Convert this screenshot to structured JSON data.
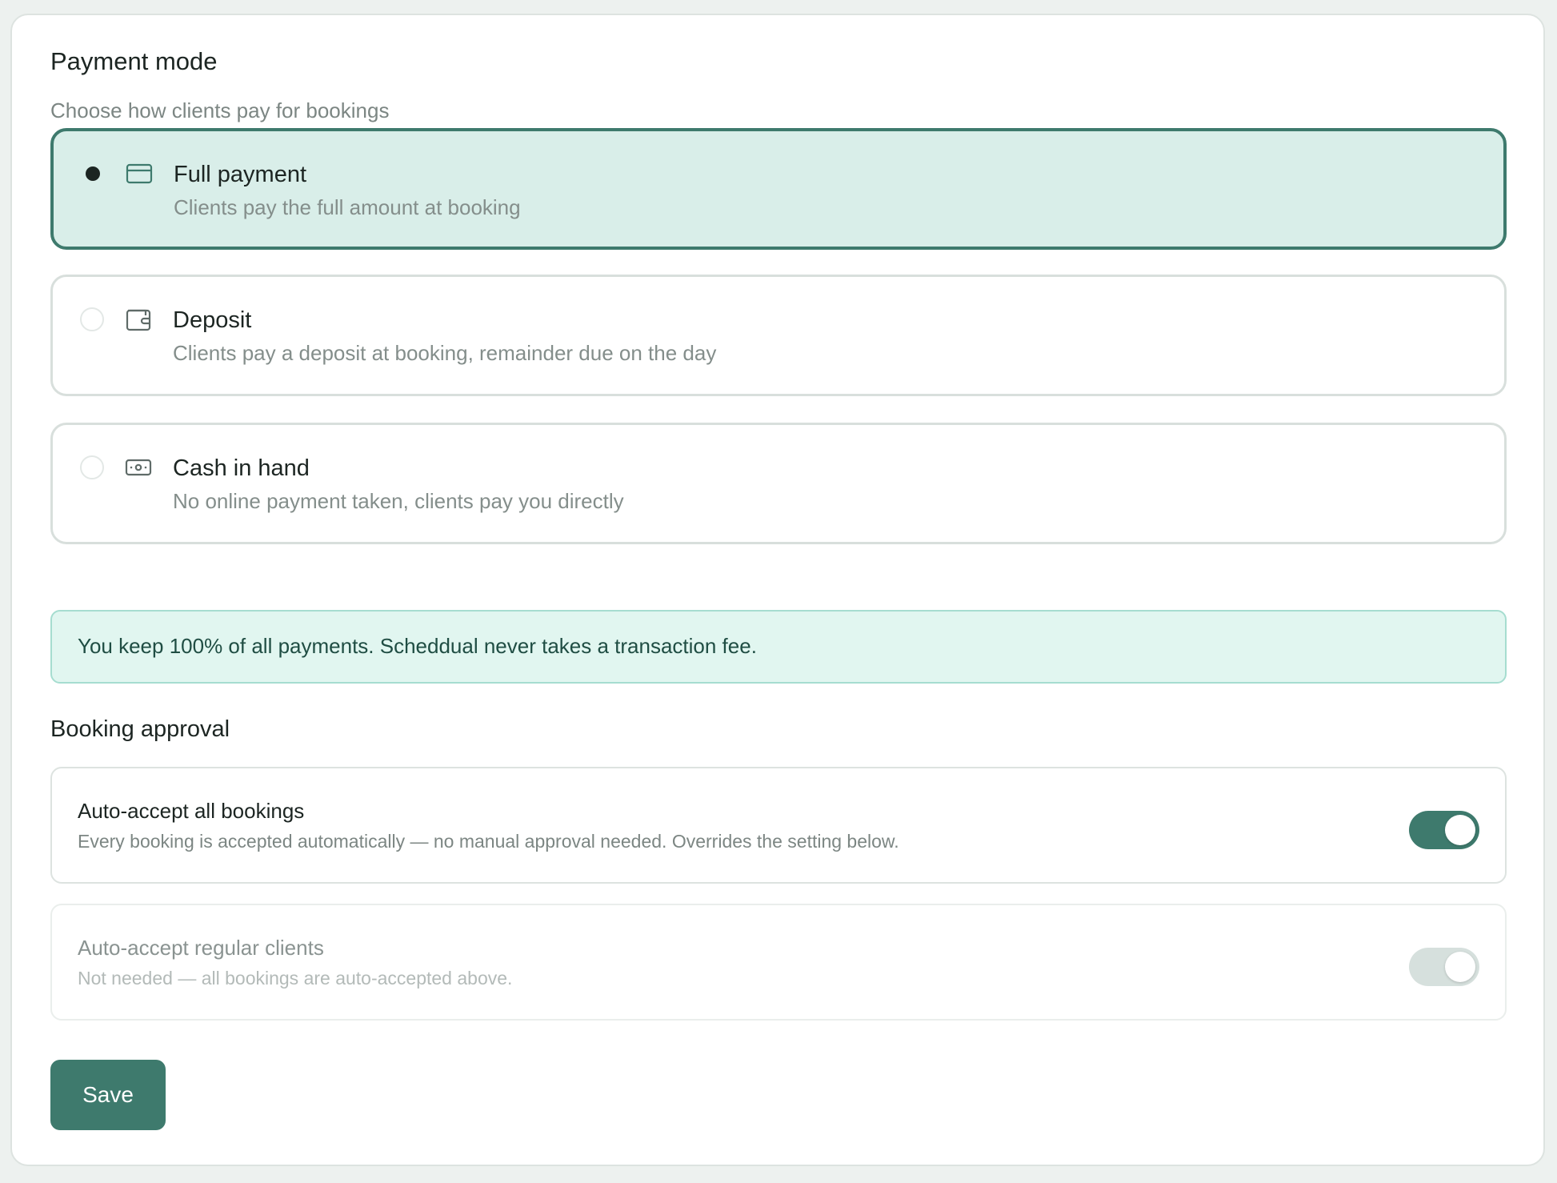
{
  "payment_mode": {
    "title": "Payment mode",
    "subtitle": "Choose how clients pay for bookings",
    "selected": "Full payment",
    "options": [
      {
        "label": "Full payment",
        "description": "Clients pay the full amount at booking",
        "icon": "credit-card-icon",
        "selected": true
      },
      {
        "label": "Deposit",
        "description": "Clients pay a deposit at booking, remainder due on the day",
        "icon": "wallet-icon",
        "selected": false
      },
      {
        "label": "Cash in hand",
        "description": "No online payment taken, clients pay you directly",
        "icon": "cash-icon",
        "selected": false
      }
    ]
  },
  "notice": {
    "text": "You keep 100% of all payments. Scheddual never takes a transaction fee."
  },
  "booking_approval": {
    "title": "Booking approval",
    "settings": [
      {
        "title": "Auto-accept all bookings",
        "description": "Every booking is accepted automatically — no manual approval needed. Overrides the setting below.",
        "enabled": true,
        "disabled": false
      },
      {
        "title": "Auto-accept regular clients",
        "description": "Not needed — all bookings are auto-accepted above.",
        "enabled": true,
        "disabled": true
      }
    ]
  },
  "actions": {
    "save_label": "Save"
  },
  "colors": {
    "accent": "#3e7a6d",
    "selected_background": "#d9eee9",
    "notice_background": "#e1f6f0",
    "notice_border": "#a6ddd0",
    "page_background": "#edf1ef"
  }
}
